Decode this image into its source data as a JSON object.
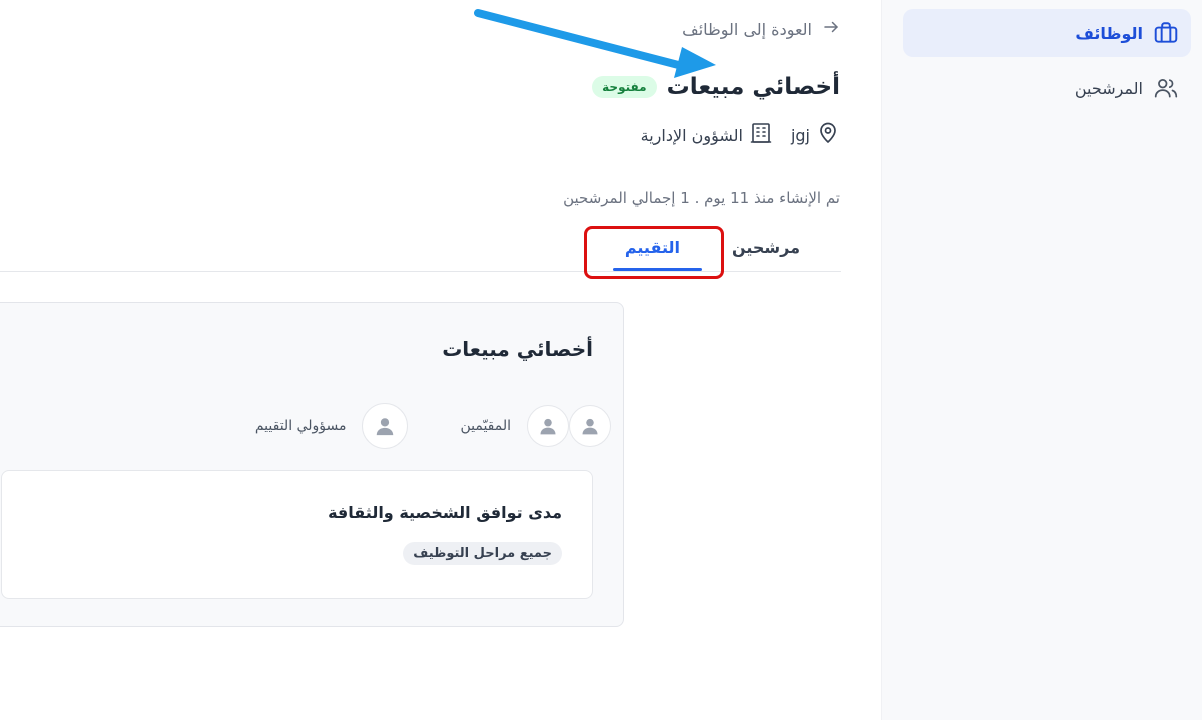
{
  "sidebar": {
    "items": [
      {
        "label": "الوظائف",
        "icon": "briefcase-icon",
        "active": true
      },
      {
        "label": "المرشحين",
        "icon": "users-icon",
        "active": false
      }
    ]
  },
  "header": {
    "back_label": "العودة إلى الوظائف",
    "title": "أخصائي مبيعات",
    "status_badge": "مفتوحة",
    "location": "jgj",
    "department": "الشؤون الإدارية",
    "created_info": "تم الإنشاء منذ 11 يوم . 1 إجمالي المرشحين"
  },
  "tabs": [
    {
      "label": "مرشحين",
      "active": false
    },
    {
      "label": "التقييم",
      "active": true
    }
  ],
  "evaluation_card": {
    "title": "أخصائي مبيعات",
    "owner_label": "مسؤولي التقييم",
    "evaluators_label": "المقيّمين",
    "criterion": {
      "title": "مدى توافق الشخصية والثقافة",
      "stage": "جميع مراحل التوظيف"
    }
  },
  "colors": {
    "accent": "#2563eb",
    "highlight": "#dc1010",
    "badge_bg": "#dcfce7",
    "badge_text": "#15803d",
    "annotation_arrow": "#1e9ae8"
  }
}
